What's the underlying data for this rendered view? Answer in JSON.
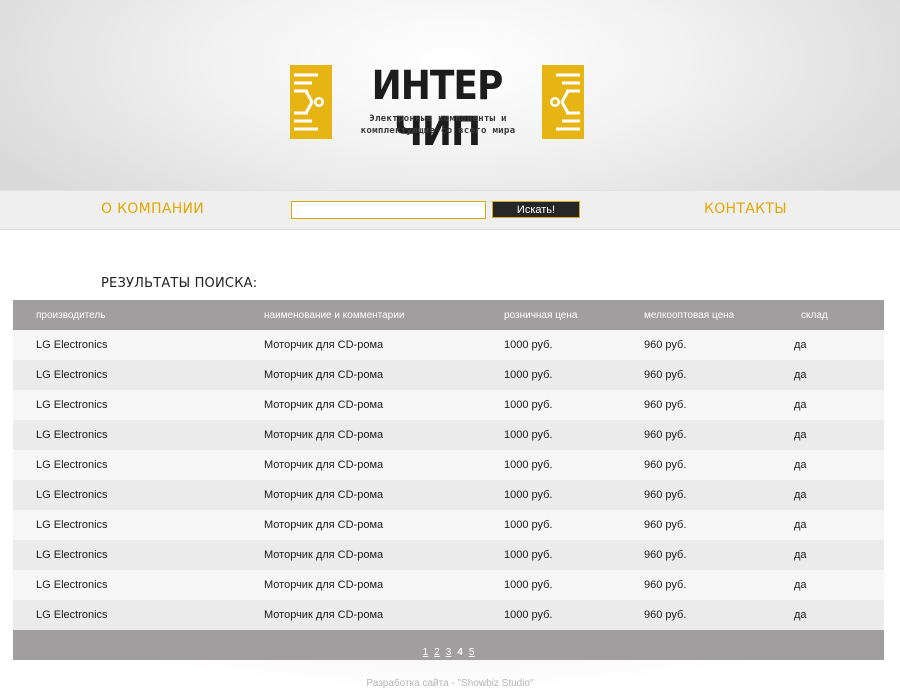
{
  "colors": {
    "accent": "#e3a800",
    "logo_yellow": "#e6b514",
    "table_header": "#a09e9f"
  },
  "logo": {
    "title": "ИНТЕР ЧИП",
    "subtitle_line1": "Электронные компоненты и",
    "subtitle_line2": "комплектующие со всего мира"
  },
  "nav": {
    "about": "О КОМПАНИИ",
    "contacts": "КОНТАКТЫ",
    "search_value": "",
    "search_button": "Искать!"
  },
  "results": {
    "title": "РЕЗУЛЬТАТЫ ПОИСКА:",
    "columns": [
      "производитель",
      "наименование и комментарии",
      "розничная цена",
      "мелкооптовая цена",
      "склад"
    ],
    "rows": [
      [
        "LG Electronics",
        "Моторчик для CD-рома",
        "1000 руб.",
        "960 руб.",
        "да"
      ],
      [
        "LG Electronics",
        "Моторчик для CD-рома",
        "1000 руб.",
        "960 руб.",
        "да"
      ],
      [
        "LG Electronics",
        "Моторчик для CD-рома",
        "1000 руб.",
        "960 руб.",
        "да"
      ],
      [
        "LG Electronics",
        "Моторчик для CD-рома",
        "1000 руб.",
        "960 руб.",
        "да"
      ],
      [
        "LG Electronics",
        "Моторчик для CD-рома",
        "1000 руб.",
        "960 руб.",
        "да"
      ],
      [
        "LG Electronics",
        "Моторчик для CD-рома",
        "1000 руб.",
        "960 руб.",
        "да"
      ],
      [
        "LG Electronics",
        "Моторчик для CD-рома",
        "1000 руб.",
        "960 руб.",
        "да"
      ],
      [
        "LG Electronics",
        "Моторчик для CD-рома",
        "1000 руб.",
        "960 руб.",
        "да"
      ],
      [
        "LG Electronics",
        "Моторчик для CD-рома",
        "1000 руб.",
        "960 руб.",
        "да"
      ],
      [
        "LG Electronics",
        "Моторчик для CD-рома",
        "1000 руб.",
        "960 руб.",
        "да"
      ]
    ]
  },
  "pagination": {
    "pages": [
      "1",
      "2",
      "3",
      "4",
      "5"
    ],
    "current": "4"
  },
  "footer": {
    "text": "Разработка сайта - \"Showbiz Studio\""
  }
}
